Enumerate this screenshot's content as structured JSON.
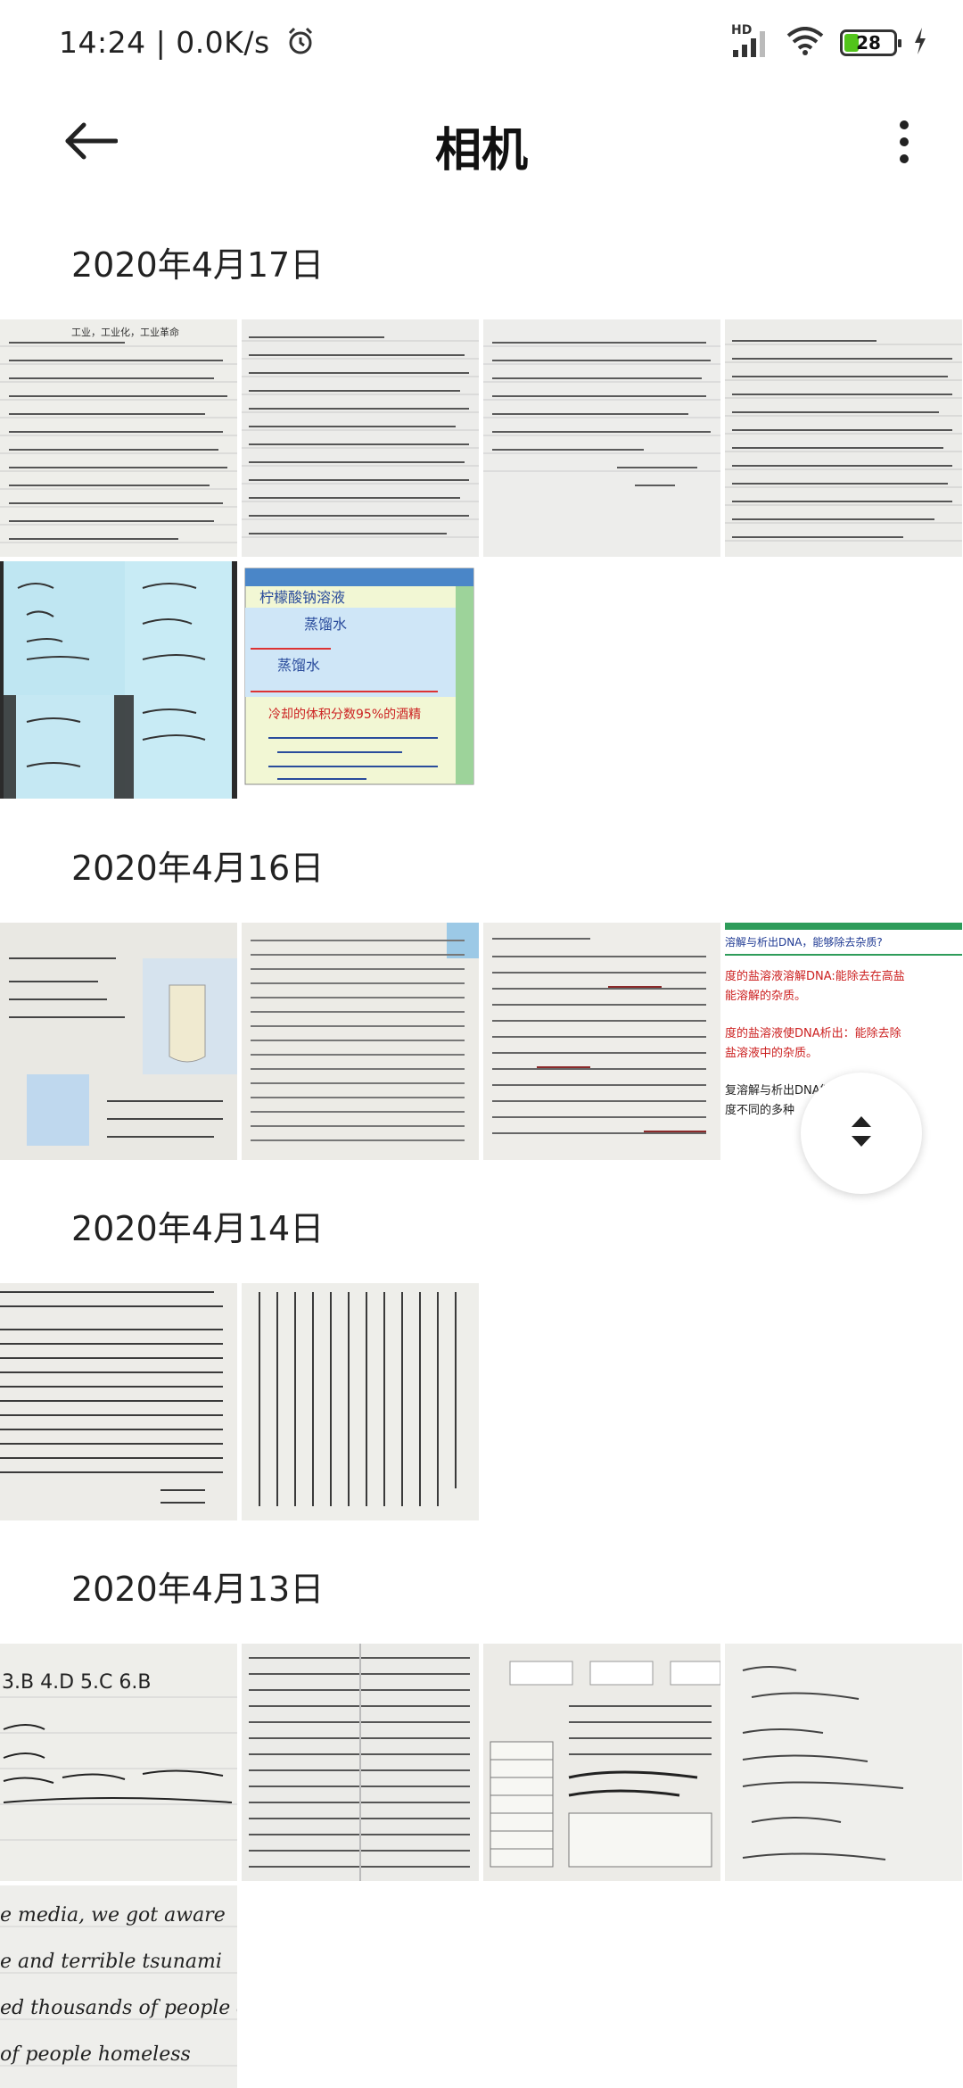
{
  "status_bar": {
    "time": "14:24 | 0.0K/s",
    "network": "HD",
    "battery": "28"
  },
  "header": {
    "title": "相机"
  },
  "sections": [
    {
      "date": "2020年4月17日",
      "count": 6
    },
    {
      "date": "2020年4月16日",
      "count": 4
    },
    {
      "date": "2020年4月14日",
      "count": 2
    },
    {
      "date": "2020年4月13日",
      "count": 5
    }
  ],
  "thumbnails": {
    "s1_p1": "工业，工业化，工业革命",
    "s1_p6_title": "柠檬酸钠溶液",
    "s1_p6_row1": "蒸馏水",
    "s1_p6_row2": "蒸馏水",
    "s1_p6_row3": "冷却的体积分数95%的酒精",
    "s2_p4_line1": "溶解与析出DNA，能够除去杂质?",
    "s2_p4_line2": "度的盐溶液溶解DNA:能除去在高盐",
    "s2_p4_line3": "能溶解的杂质。",
    "s2_p4_line4": "度的盐溶液使DNA析出：能除去除",
    "s2_p4_line5": "盐溶液中的杂质。",
    "s2_p4_line6": "复溶解与析出DNA能够除去与",
    "s2_p4_line7": "度不同的多种",
    "s4_p1_line1": "3.B 4.D 5.C 6.B",
    "s4_p5_line1": "e media, we got aware",
    "s4_p5_line2": "e and terrible tsunami",
    "s4_p5_line3": "ed thousands of people dead",
    "s4_p5_line4": "of people homeless"
  },
  "colors": {
    "battery_fill": "#52c41a",
    "fab_icon": "#222222"
  },
  "icons": {
    "back": "arrow-left-icon",
    "more": "more-vertical-icon",
    "fab": "scroll-handle-icon"
  }
}
